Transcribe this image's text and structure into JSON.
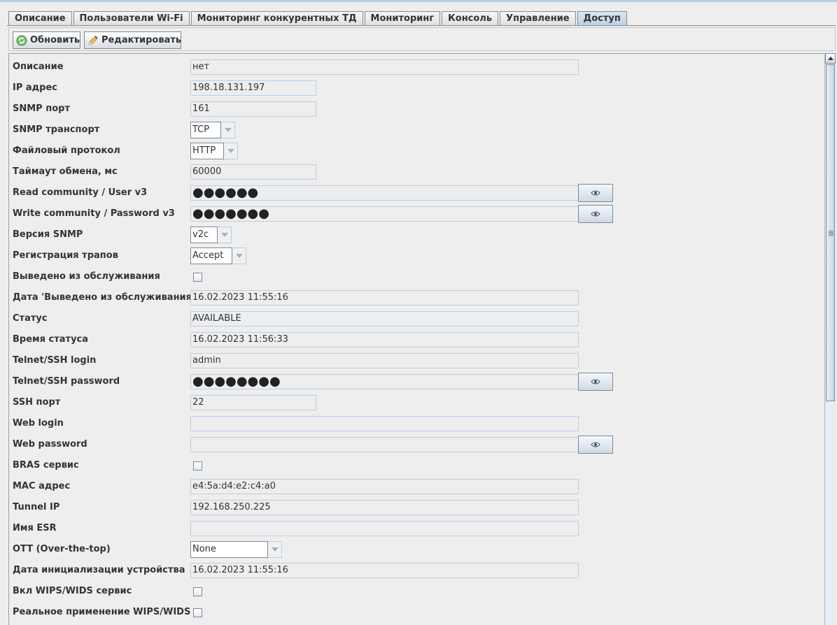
{
  "tabs": [
    {
      "label": "Описание",
      "active": false
    },
    {
      "label": "Пользователи Wi-Fi",
      "active": false
    },
    {
      "label": "Мониторинг конкурентных ТД",
      "active": false
    },
    {
      "label": "Мониторинг",
      "active": false
    },
    {
      "label": "Консоль",
      "active": false
    },
    {
      "label": "Управление",
      "active": false
    },
    {
      "label": "Доступ",
      "active": true
    }
  ],
  "toolbar": {
    "refresh_label": "Обновить",
    "edit_label": "Редактировать"
  },
  "form": {
    "description": {
      "label": "Описание",
      "value": "нет"
    },
    "ip": {
      "label": "IP адрес",
      "value": "198.18.131.197"
    },
    "snmp_port": {
      "label": "SNMP порт",
      "value": "161"
    },
    "snmp_transport": {
      "label": "SNMP транспорт",
      "value": "TCP"
    },
    "file_protocol": {
      "label": "Файловый протокол",
      "value": "HTTP"
    },
    "timeout": {
      "label": "Таймаут обмена, мс",
      "value": "60000"
    },
    "read_community": {
      "label": "Read community / User v3",
      "value": "●●●●●●"
    },
    "write_community": {
      "label": "Write community / Password v3",
      "value": "●●●●●●●"
    },
    "snmp_version": {
      "label": "Версия SNMP",
      "value": "v2c"
    },
    "trap_registration": {
      "label": "Регистрация трапов",
      "value": "Accept"
    },
    "out_of_service": {
      "label": "Выведено из обслуживания",
      "checked": false
    },
    "out_of_service_date": {
      "label": "Дата 'Выведено из обслуживания'",
      "value": "16.02.2023 11:55:16"
    },
    "status": {
      "label": "Статус",
      "value": "AVAILABLE"
    },
    "status_time": {
      "label": "Время статуса",
      "value": "16.02.2023 11:56:33"
    },
    "telnet_login": {
      "label": "Telnet/SSH login",
      "value": "admin"
    },
    "telnet_password": {
      "label": "Telnet/SSH password",
      "value": "●●●●●●●●"
    },
    "ssh_port": {
      "label": "SSH порт",
      "value": "22"
    },
    "web_login": {
      "label": "Web login",
      "value": ""
    },
    "web_password": {
      "label": "Web password",
      "value": ""
    },
    "bras_service": {
      "label": "BRAS сервис",
      "checked": false
    },
    "mac": {
      "label": "MAC адрес",
      "value": "e4:5a:d4:e2:c4:a0"
    },
    "tunnel_ip": {
      "label": "Tunnel IP",
      "value": "192.168.250.225"
    },
    "esr_name": {
      "label": "Имя ESR",
      "value": ""
    },
    "ott": {
      "label": "OTT (Over-the-top)",
      "value": "None"
    },
    "init_date": {
      "label": "Дата инициализации устройства",
      "value": "16.02.2023 11:55:16"
    },
    "wips_service": {
      "label": "Вкл WIPS/WIDS сервис",
      "checked": false
    },
    "wips_real": {
      "label": "Реальное применение WIPS/WIDS",
      "checked": false
    }
  },
  "icons": {
    "refresh": "refresh-icon",
    "edit": "pencil-icon",
    "show_password": "eye-icon"
  },
  "colors": {
    "active_tab": "#b8cfe5",
    "field_border": "#b8cfe5",
    "background": "#eeeeee"
  }
}
